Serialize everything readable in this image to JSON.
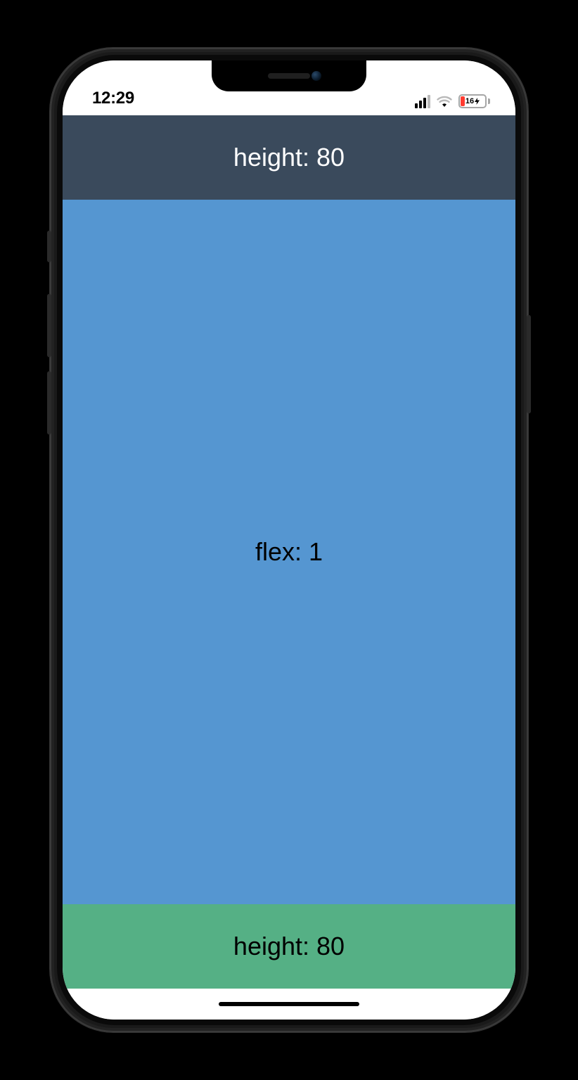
{
  "statusBar": {
    "time": "12:29",
    "batteryText": "16"
  },
  "layout": {
    "topLabel": "height: 80",
    "middleLabel": "flex: 1",
    "bottomLabel": "height: 80"
  },
  "colors": {
    "topBg": "#3a4a5c",
    "middleBg": "#5596d1",
    "bottomBg": "#55b085"
  }
}
